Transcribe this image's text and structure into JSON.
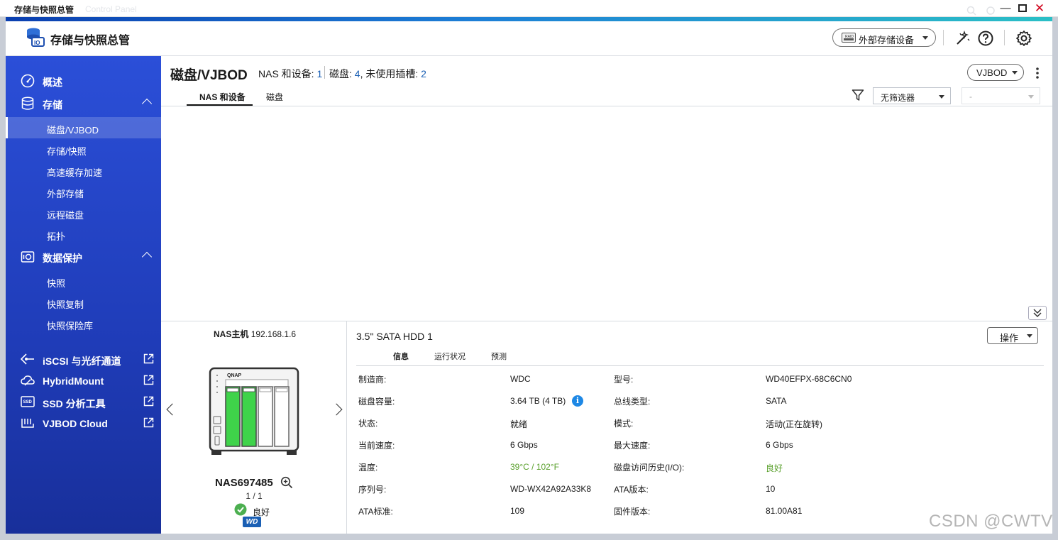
{
  "window": {
    "title": "存储与快照总管",
    "ghost_text": "Control Panel",
    "minimize": "—",
    "maximize": "□",
    "close": "✕"
  },
  "header": {
    "app_title": "存储与快照总管",
    "external_storage_label": "外部存储设备",
    "icons": [
      "raid-icon",
      "wand-icon",
      "help-icon",
      "settings-icon"
    ]
  },
  "sidebar": {
    "overview": "概述",
    "storage": {
      "label": "存储",
      "items": [
        "磁盘/VJBOD",
        "存储/快照",
        "高速缓存加速",
        "外部存储",
        "远程磁盘",
        "拓扑"
      ]
    },
    "data_protection": {
      "label": "数据保护",
      "items": [
        "快照",
        "快照复制",
        "快照保险库"
      ]
    },
    "external_links": [
      "iSCSI 与光纤通道",
      "HybridMount",
      "SSD 分析工具",
      "VJBOD Cloud"
    ]
  },
  "main": {
    "title": "磁盘/VJBOD",
    "nas_label": "NAS 和设备:",
    "nas_count": "1",
    "disk_label": "磁盘:",
    "disk_count": "4",
    "unused_label": ", 未使用插槽:",
    "unused_count": "2",
    "vjbod_button": "VJBOD",
    "kebab": "⋮",
    "tabs": [
      "NAS 和设备",
      "磁盘"
    ],
    "filter_value": "无筛选器",
    "filter2_value": "-"
  },
  "nas": {
    "host_label": "NAS主机",
    "host_ip": "192.168.1.6",
    "name": "NAS697485",
    "page": "1 / 1",
    "status": "良好",
    "brand_logo": "WD",
    "device_brand": "QNAP"
  },
  "disk": {
    "title": "3.5\" SATA HDD 1",
    "op_button": "操作",
    "tabs": [
      "信息",
      "运行状况",
      "预测"
    ],
    "left": [
      {
        "label": "制造商:",
        "value": "WDC"
      },
      {
        "label": "磁盘容量:",
        "value": "3.64 TB (4 TB)"
      },
      {
        "label": "状态:",
        "value": "就绪"
      },
      {
        "label": "当前速度:",
        "value": "6 Gbps"
      },
      {
        "label": "温度:",
        "value": "39°C / 102°F"
      },
      {
        "label": "序列号:",
        "value": "WD-WX42A92A33K8"
      },
      {
        "label": "ATA标准:",
        "value": "109"
      }
    ],
    "right": [
      {
        "label": "型号:",
        "value": "WD40EFPX-68C6CN0"
      },
      {
        "label": "总线类型:",
        "value": "SATA"
      },
      {
        "label": "模式:",
        "value": "活动(正在旋转)"
      },
      {
        "label": "最大速度:",
        "value": "6 Gbps"
      },
      {
        "label": "磁盘访问历史(I/O):",
        "value": "良好"
      },
      {
        "label": "ATA版本:",
        "value": "10"
      },
      {
        "label": "固件版本:",
        "value": "81.00A81"
      }
    ],
    "info_icon": "i",
    "status_green": "#5aa02c"
  },
  "watermark": "CSDN @CWTV"
}
